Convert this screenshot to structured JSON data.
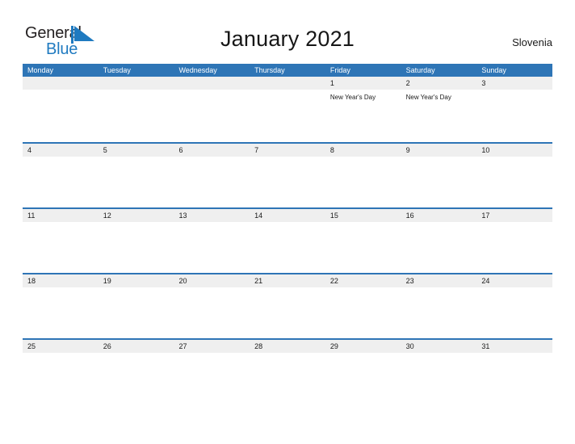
{
  "brand": {
    "name_part1": "General",
    "name_part2": "Blue",
    "mark_icon": "blue-triangle-flag-icon",
    "color_dark": "#231f20",
    "color_blue": "#1f7ac0"
  },
  "header": {
    "title": "January 2021",
    "region": "Slovenia"
  },
  "colors": {
    "header_blue": "#2e75b6",
    "date_band_gray": "#efefef",
    "row_divider_blue": "#2e75b6",
    "text_dark": "#1a1a1a",
    "page_background": "#ffffff"
  },
  "calendar": {
    "month": "January",
    "year": "2021",
    "weekday_headers": [
      "Monday",
      "Tuesday",
      "Wednesday",
      "Thursday",
      "Friday",
      "Saturday",
      "Sunday"
    ],
    "weeks": [
      {
        "days": [
          {
            "num": "",
            "events": []
          },
          {
            "num": "",
            "events": []
          },
          {
            "num": "",
            "events": []
          },
          {
            "num": "",
            "events": []
          },
          {
            "num": "1",
            "events": [
              "New Year's Day"
            ]
          },
          {
            "num": "2",
            "events": [
              "New Year's Day"
            ]
          },
          {
            "num": "3",
            "events": []
          }
        ]
      },
      {
        "days": [
          {
            "num": "4",
            "events": []
          },
          {
            "num": "5",
            "events": []
          },
          {
            "num": "6",
            "events": []
          },
          {
            "num": "7",
            "events": []
          },
          {
            "num": "8",
            "events": []
          },
          {
            "num": "9",
            "events": []
          },
          {
            "num": "10",
            "events": []
          }
        ]
      },
      {
        "days": [
          {
            "num": "11",
            "events": []
          },
          {
            "num": "12",
            "events": []
          },
          {
            "num": "13",
            "events": []
          },
          {
            "num": "14",
            "events": []
          },
          {
            "num": "15",
            "events": []
          },
          {
            "num": "16",
            "events": []
          },
          {
            "num": "17",
            "events": []
          }
        ]
      },
      {
        "days": [
          {
            "num": "18",
            "events": []
          },
          {
            "num": "19",
            "events": []
          },
          {
            "num": "20",
            "events": []
          },
          {
            "num": "21",
            "events": []
          },
          {
            "num": "22",
            "events": []
          },
          {
            "num": "23",
            "events": []
          },
          {
            "num": "24",
            "events": []
          }
        ]
      },
      {
        "days": [
          {
            "num": "25",
            "events": []
          },
          {
            "num": "26",
            "events": []
          },
          {
            "num": "27",
            "events": []
          },
          {
            "num": "28",
            "events": []
          },
          {
            "num": "29",
            "events": []
          },
          {
            "num": "30",
            "events": []
          },
          {
            "num": "31",
            "events": []
          }
        ]
      }
    ]
  }
}
